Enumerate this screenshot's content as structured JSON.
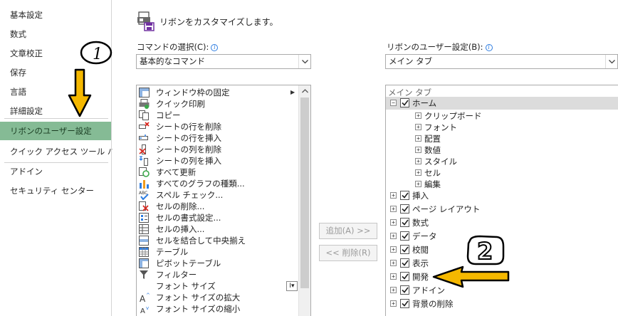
{
  "sidebar": {
    "items": [
      {
        "label": "基本設定",
        "selected": false
      },
      {
        "label": "数式",
        "selected": false
      },
      {
        "label": "文章校正",
        "selected": false
      },
      {
        "label": "保存",
        "selected": false
      },
      {
        "label": "言語",
        "selected": false
      },
      {
        "label": "詳細設定",
        "selected": false
      },
      {
        "label": "リボンのユーザー設定",
        "selected": true
      },
      {
        "label": "クイック アクセス ツール バー",
        "selected": false
      },
      {
        "label": "アドイン",
        "selected": false
      },
      {
        "label": "セキュリティ センター",
        "selected": false
      }
    ]
  },
  "header": {
    "title": "リボンをカスタマイズします。",
    "icon": "ribbon-customize-icon"
  },
  "commands": {
    "label": "コマンドの選択(C):",
    "selected": "基本的なコマンド",
    "items": [
      {
        "label": "ウィンドウ枠の固定",
        "icon": "freeze-panes-icon",
        "submenu": true
      },
      {
        "label": "クイック印刷",
        "icon": "quick-print-icon"
      },
      {
        "label": "コピー",
        "icon": "copy-icon"
      },
      {
        "label": "シートの行を削除",
        "icon": "delete-row-icon"
      },
      {
        "label": "シートの行を挿入",
        "icon": "insert-row-icon"
      },
      {
        "label": "シートの列を削除",
        "icon": "delete-column-icon"
      },
      {
        "label": "シートの列を挿入",
        "icon": "insert-column-icon"
      },
      {
        "label": "すべて更新",
        "icon": "refresh-all-icon"
      },
      {
        "label": "すべてのグラフの種類...",
        "icon": "chart-types-icon"
      },
      {
        "label": "スペル チェック...",
        "icon": "spell-check-icon"
      },
      {
        "label": "セルの削除...",
        "icon": "delete-cells-icon"
      },
      {
        "label": "セルの書式設定...",
        "icon": "format-cells-icon"
      },
      {
        "label": "セルの挿入...",
        "icon": "insert-cells-icon"
      },
      {
        "label": "セルを結合して中央揃え",
        "icon": "merge-center-icon"
      },
      {
        "label": "テーブル",
        "icon": "table-icon"
      },
      {
        "label": "ピボットテーブル",
        "icon": "pivot-table-icon"
      },
      {
        "label": "フィルター",
        "icon": "filter-icon"
      },
      {
        "label": "フォント サイズ",
        "icon": "font-size-icon",
        "dropdown": true
      },
      {
        "label": "フォント サイズの拡大",
        "icon": "grow-font-icon"
      },
      {
        "label": "フォント サイズの縮小",
        "icon": "shrink-font-icon"
      }
    ]
  },
  "buttons": {
    "add": "追加(A) >>",
    "remove": "<< 削除(R)"
  },
  "ribbon": {
    "label": "リボンのユーザー設定(B):",
    "selected": "メイン タブ",
    "tree_header": "メイン タブ",
    "tabs": [
      {
        "label": "ホーム",
        "checked": true,
        "expanded": true,
        "groups": [
          "クリップボード",
          "フォント",
          "配置",
          "数値",
          "スタイル",
          "セル",
          "編集"
        ]
      },
      {
        "label": "挿入",
        "checked": true
      },
      {
        "label": "ページ レイアウト",
        "checked": true
      },
      {
        "label": "数式",
        "checked": true
      },
      {
        "label": "データ",
        "checked": true
      },
      {
        "label": "校閲",
        "checked": true
      },
      {
        "label": "表示",
        "checked": true
      },
      {
        "label": "開発",
        "checked": true
      },
      {
        "label": "アドイン",
        "checked": true
      },
      {
        "label": "背景の削除",
        "checked": true
      }
    ]
  },
  "annotations": {
    "mark1": "1",
    "mark2": "2",
    "arrow_color": "#f5b800"
  }
}
